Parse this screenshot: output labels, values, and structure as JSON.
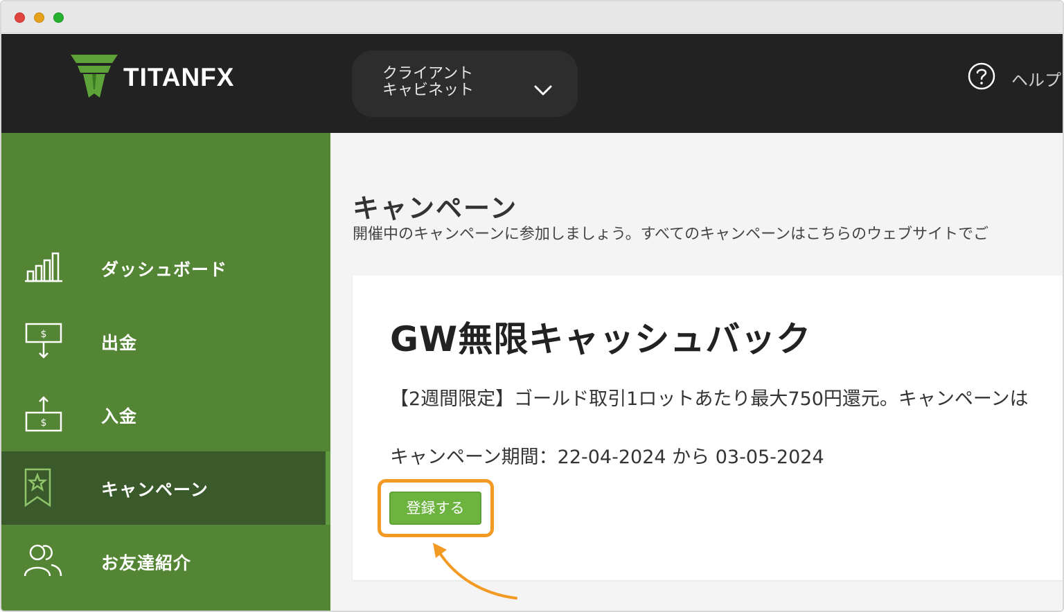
{
  "brand": {
    "logo_text": "TITANFX",
    "logo_color": "#5ea33a"
  },
  "header": {
    "cabinet_select_label": "クライアント\nキャビネット",
    "help_label": "ヘルプ"
  },
  "sidebar": {
    "items": [
      {
        "label": "ダッシュボード",
        "icon": "bar-chart-icon",
        "active": false
      },
      {
        "label": "出金",
        "icon": "withdraw-icon",
        "active": false
      },
      {
        "label": "入金",
        "icon": "deposit-icon",
        "active": false
      },
      {
        "label": "キャンペーン",
        "icon": "campaign-star-icon",
        "active": true
      },
      {
        "label": "お友達紹介",
        "icon": "referral-users-icon",
        "active": false
      }
    ]
  },
  "main": {
    "title": "キャンペーン",
    "subtitle": "開催中のキャンペーンに参加しましょう。すべてのキャンペーンはこちらのウェブサイトでご",
    "campaign": {
      "title": "GW無限キャッシュバック",
      "description": "【2週間限定】ゴールド取引1ロットあたり最大750円還元。キャンペーンは",
      "period": "キャンペーン期間：22-04-2024 から 03-05-2024",
      "register_label": "登録する"
    }
  },
  "colors": {
    "header_bg": "#222222",
    "sidebar_bg": "#538535",
    "sidebar_active_bg": "#3a5a2b",
    "button_bg": "#6cb33f",
    "highlight": "#f39a25"
  }
}
